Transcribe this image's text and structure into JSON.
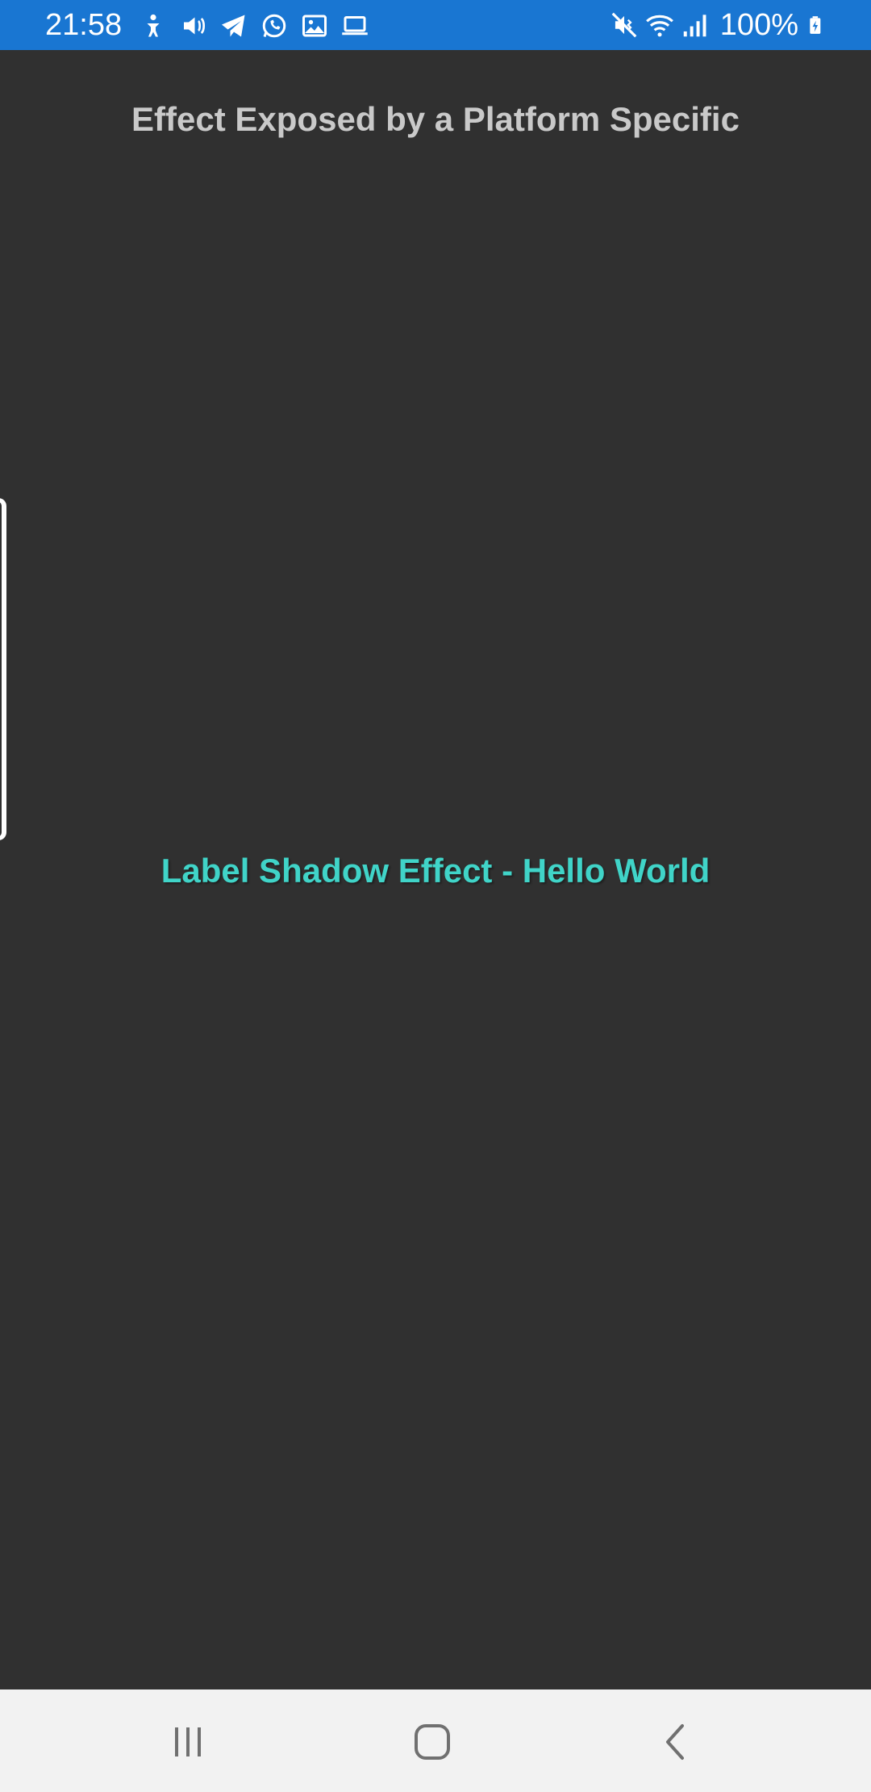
{
  "status_bar": {
    "time": "21:58",
    "battery_percent": "100%",
    "left_icons": [
      "accessibility-icon",
      "volume-icon",
      "telegram-icon",
      "whatsapp-icon",
      "gallery-icon",
      "laptop-icon"
    ],
    "right_icons": [
      "mute-vibrate-icon",
      "wifi-icon",
      "signal-icon",
      "battery-charging-icon"
    ],
    "background_color": "#1976D2"
  },
  "page": {
    "title": "Effect Exposed by a Platform Specific",
    "shadow_label": "Label Shadow Effect - Hello World",
    "background_color": "#303030",
    "label_color": "#40D4C8"
  },
  "nav_bar": {
    "buttons": [
      "recent-apps",
      "home",
      "back"
    ]
  }
}
